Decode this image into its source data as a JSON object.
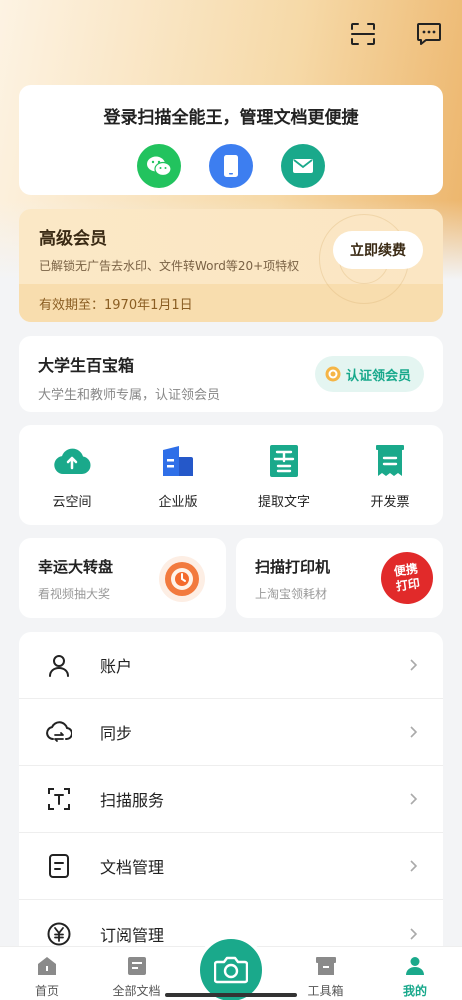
{
  "topbar": {
    "scan_icon": "scan-icon",
    "message_icon": "message-icon"
  },
  "login": {
    "title": "登录扫描全能王，管理文档更便捷",
    "options": [
      "wechat-icon",
      "phone-icon",
      "email-icon"
    ]
  },
  "vip": {
    "title": "高级会员",
    "desc": "已解锁无广告去水印、文件转Word等20+项特权",
    "button": "立即续费",
    "expiry": "有效期至：1970年1月1日"
  },
  "student": {
    "title": "大学生百宝箱",
    "desc": "大学生和教师专属，认证领会员",
    "button": "认证领会员"
  },
  "tools": [
    {
      "label": "云空间",
      "icon": "cloud-upload-icon"
    },
    {
      "label": "企业版",
      "icon": "enterprise-icon"
    },
    {
      "label": "提取文字",
      "icon": "extract-text-icon"
    },
    {
      "label": "开发票",
      "icon": "invoice-icon"
    }
  ],
  "promo": {
    "lucky": {
      "title": "幸运大转盘",
      "desc": "看视频抽大奖"
    },
    "printer": {
      "title": "扫描打印机",
      "desc": "上淘宝领耗材",
      "badge": "便携\n打印"
    }
  },
  "menu": [
    {
      "label": "账户",
      "icon": "user-icon"
    },
    {
      "label": "同步",
      "icon": "cloud-sync-icon"
    },
    {
      "label": "扫描服务",
      "icon": "scan-service-icon"
    },
    {
      "label": "文档管理",
      "icon": "document-icon"
    },
    {
      "label": "订阅管理",
      "icon": "yen-icon"
    }
  ],
  "nav": [
    {
      "label": "首页"
    },
    {
      "label": "全部文档"
    },
    {
      "label": "工具箱"
    },
    {
      "label": "我的"
    }
  ],
  "colors": {
    "accent": "#1aa98b",
    "gold": "#ecb46a"
  }
}
